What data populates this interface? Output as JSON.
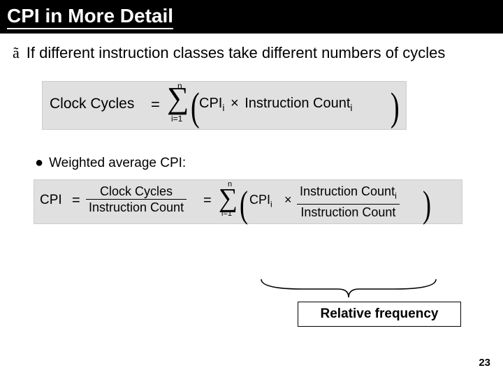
{
  "title": "CPI in More Detail",
  "top_bullet_sym": "ã",
  "top_bullet": "If different instruction classes take different numbers of cycles",
  "formula1": {
    "lhs": "Clock Cycles",
    "eq": "=",
    "sigma_sup": "n",
    "sigma_sub": "i=1",
    "term_cpi": "CPI",
    "term_cpi_sub": "i",
    "times": "×",
    "term_ic": "Instruction Count",
    "term_ic_sub": "i"
  },
  "sub_bullet_sym": "●",
  "sub_bullet": "Weighted average CPI:",
  "formula2": {
    "lhs": "CPI",
    "eq": "=",
    "frac1_top": "Clock Cycles",
    "frac1_bot": "Instruction Count",
    "sigma_sup": "n",
    "sigma_sub": "i=1",
    "term_cpi": "CPI",
    "term_cpi_sub": "i",
    "times": "×",
    "frac2_top": "Instruction Count",
    "frac2_top_sub": "i",
    "frac2_bot": "Instruction Count"
  },
  "rel_freq": "Relative frequency",
  "page_num": "23"
}
